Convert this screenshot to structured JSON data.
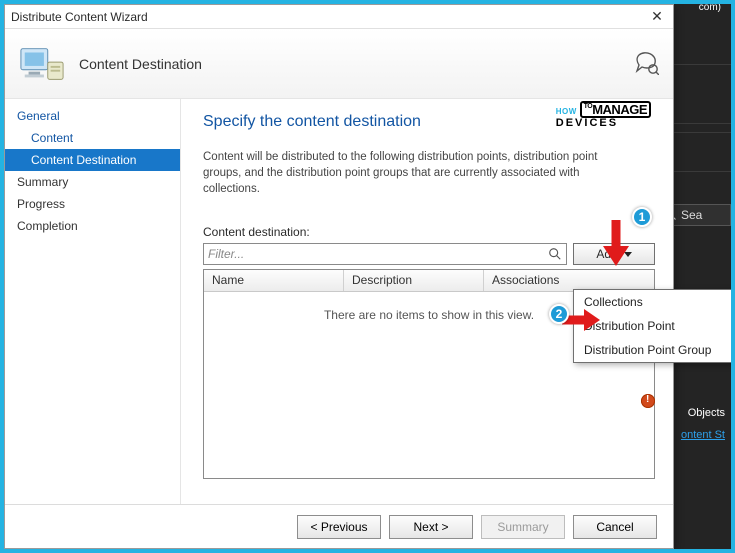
{
  "background": {
    "tag_text": "com)",
    "search_placeholder": "Sea",
    "objects_label": "Objects",
    "content_link": "ontent St"
  },
  "wizard": {
    "title": "Distribute Content Wizard",
    "banner_title": "Content Destination",
    "nav": {
      "general": "General",
      "content": "Content",
      "content_destination": "Content Destination",
      "summary": "Summary",
      "progress": "Progress",
      "completion": "Completion"
    },
    "main": {
      "heading": "Specify the content destination",
      "description": "Content will be distributed to the following distribution points, distribution point groups, and the distribution point groups that are currently associated with collections.",
      "dest_label": "Content destination:",
      "filter_placeholder": "Filter...",
      "add_label": "Add",
      "columns": {
        "name": "Name",
        "description": "Description",
        "associations": "Associations"
      },
      "empty_text": "There are no items to show in this view.",
      "dropdown": {
        "collections": "Collections",
        "dp": "Distribution Point",
        "dpg": "Distribution Point Group"
      }
    },
    "footer": {
      "previous": "< Previous",
      "next": "Next >",
      "summary": "Summary",
      "cancel": "Cancel"
    }
  },
  "watermark": {
    "how": "HOW",
    "to": "TO",
    "manage": "MANAGE",
    "devices": "DEVICES"
  },
  "annotations": {
    "one": "1",
    "two": "2"
  }
}
